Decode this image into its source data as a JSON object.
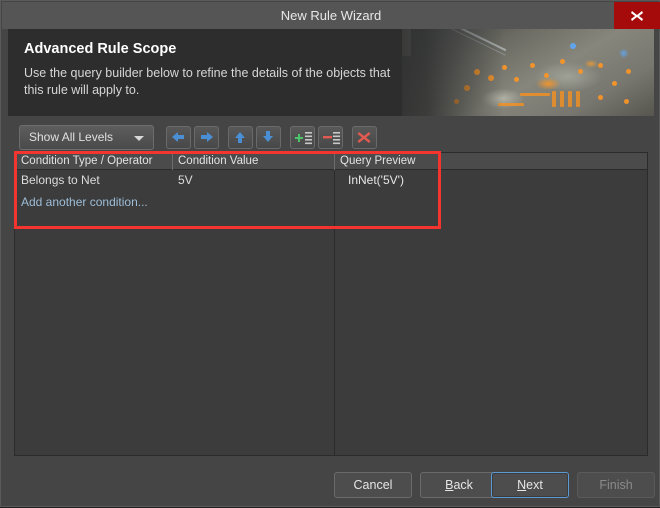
{
  "window": {
    "title": "New Rule Wizard",
    "close_icon": "close-icon"
  },
  "header": {
    "title": "Advanced Rule Scope",
    "subtitle": "Use the query builder below to refine the details of the objects that this rule will apply to."
  },
  "toolbar": {
    "level_filter": {
      "value": "Show All Levels",
      "chevron_icon": "chevron-down-icon"
    },
    "buttons": [
      {
        "name": "move-left-button",
        "icon": "arrow-left-icon",
        "title": "Move Left"
      },
      {
        "name": "move-right-button",
        "icon": "arrow-right-icon",
        "title": "Move Right"
      },
      {
        "name": "move-up-button",
        "icon": "arrow-up-icon",
        "title": "Move Up"
      },
      {
        "name": "move-down-button",
        "icon": "arrow-down-icon",
        "title": "Move Down"
      },
      {
        "name": "add-condition-button",
        "icon": "add-row-icon",
        "title": "Add Condition"
      },
      {
        "name": "remove-condition-button",
        "icon": "remove-row-icon",
        "title": "Remove Condition"
      },
      {
        "name": "clear-all-button",
        "icon": "delete-x-icon",
        "title": "Clear All"
      }
    ]
  },
  "table": {
    "columns": [
      "Condition Type / Operator",
      "Condition Value",
      "Query Preview"
    ],
    "rows": [
      {
        "condition_type": "Belongs to Net",
        "condition_value": "5V",
        "query_preview": "InNet('5V')"
      }
    ],
    "add_row_label": "Add another condition..."
  },
  "footer": {
    "buttons": [
      {
        "name": "cancel-button",
        "label": "Cancel",
        "state": "normal",
        "mnemonic": ""
      },
      {
        "name": "back-button",
        "label": "Back",
        "state": "normal",
        "mnemonic": "B"
      },
      {
        "name": "next-button",
        "label": "Next",
        "state": "focused",
        "mnemonic": "N"
      },
      {
        "name": "finish-button",
        "label": "Finish",
        "state": "disabled",
        "mnemonic": ""
      }
    ]
  },
  "colors": {
    "dialog_bg": "#454545",
    "titlebar_bg": "#555555",
    "banner_bg": "#2d2d2d",
    "table_bg": "#3c3c3c",
    "table_header_bg": "#4b4b4b",
    "close_red": "#a50b0b",
    "annotation_red": "#f4352f",
    "link_blue": "#9dbdd8",
    "accent_focus": "#5b9ad4",
    "icon_blue": "#4a8fd4",
    "icon_green": "#4cc46a",
    "icon_red": "#e05a52"
  }
}
